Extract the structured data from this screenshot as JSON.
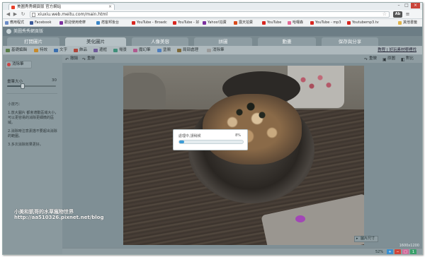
{
  "browser": {
    "tab_title": "美圖秀秀網頁版 官方網站",
    "url": "xiuxiu.web.meitu.com/main.html",
    "window_controls": [
      "–",
      "□",
      "×"
    ]
  },
  "bookmarks": [
    {
      "label": "應用程式",
      "color": "#6b8cc7"
    },
    {
      "label": "Facebook",
      "color": "#3b5998"
    },
    {
      "label": "歡迎使用奇摩",
      "color": "#7b2f9e"
    },
    {
      "label": "痞客邦後台",
      "color": "#3a86c8"
    },
    {
      "label": "YouTube - Broadc",
      "color": "#d8261f"
    },
    {
      "label": "YouTube - 好",
      "color": "#d8261f"
    },
    {
      "label": "Yahoo!拍賣",
      "color": "#7b2f9e"
    },
    {
      "label": "露天拍賣",
      "color": "#d84a1b"
    },
    {
      "label": "YouTube",
      "color": "#d8261f"
    },
    {
      "label": "哈囉森",
      "color": "#e56a96"
    },
    {
      "label": "YouTube - mp3",
      "color": "#d8261f"
    },
    {
      "label": "Youtubemp3.tv",
      "color": "#d8261f"
    },
    {
      "label": "其他書籤",
      "color": "#e0b34a"
    }
  ],
  "app": {
    "title": "美圖秀秀網頁版"
  },
  "main_tabs": [
    "打開圖片",
    "美化圖片",
    "人像美容",
    "拼圖",
    "動畫",
    "保存與分享"
  ],
  "active_tab": "美化圖片",
  "tools": [
    {
      "label": "基礎編輯",
      "icon": "edit-icon",
      "color": "#5a7d4a"
    },
    {
      "label": "特效",
      "icon": "magic-icon",
      "color": "#c78a2c"
    },
    {
      "label": "文字",
      "icon": "text-icon",
      "color": "#3a6fb0"
    },
    {
      "label": "飾品",
      "icon": "ornament-icon",
      "color": "#b0463a"
    },
    {
      "label": "邊框",
      "icon": "frame-icon",
      "color": "#6f5a9a"
    },
    {
      "label": "場景",
      "icon": "scene-icon",
      "color": "#3f8f7a"
    },
    {
      "label": "魔幻筆",
      "icon": "magic-pen-icon",
      "color": "#b05a8f"
    },
    {
      "label": "塗鴉",
      "icon": "doodle-icon",
      "color": "#4f7fbf"
    },
    {
      "label": "局部處理",
      "icon": "local-edit-icon",
      "color": "#7f6a3a"
    },
    {
      "label": "消除筆",
      "icon": "eraser-icon",
      "color": "#9a9a9a"
    }
  ],
  "tools_link": "教程 | 好玩素材哪裡找",
  "left_panel": {
    "subtab": "消除筆",
    "size_label": "畫筆大小",
    "size_value": "30",
    "size_fraction": 0.32,
    "tips_title": "小技巧：",
    "tips": [
      "1.放大圖片 都會適動區域大小，可以更容易的消除更細微的區域。",
      "2.消除時注意素描不要超出消除的範圍。",
      "3.多次消除效果更好。"
    ]
  },
  "subbar": {
    "left": [
      "撤銷",
      "重做"
    ],
    "right": [
      "重做",
      "原圖",
      "對比"
    ]
  },
  "dialog": {
    "message": "處理中,請稍候",
    "percent_label": "8%",
    "progress": 0.08
  },
  "watermark": {
    "line1": "小美和凱哥的水草瘋物世界",
    "line2": "http://aa510326.pixnet.net/blog"
  },
  "status": {
    "image_size_label": "圖片尺寸",
    "image_size_value": "1600x1200",
    "zoom": "52%"
  }
}
